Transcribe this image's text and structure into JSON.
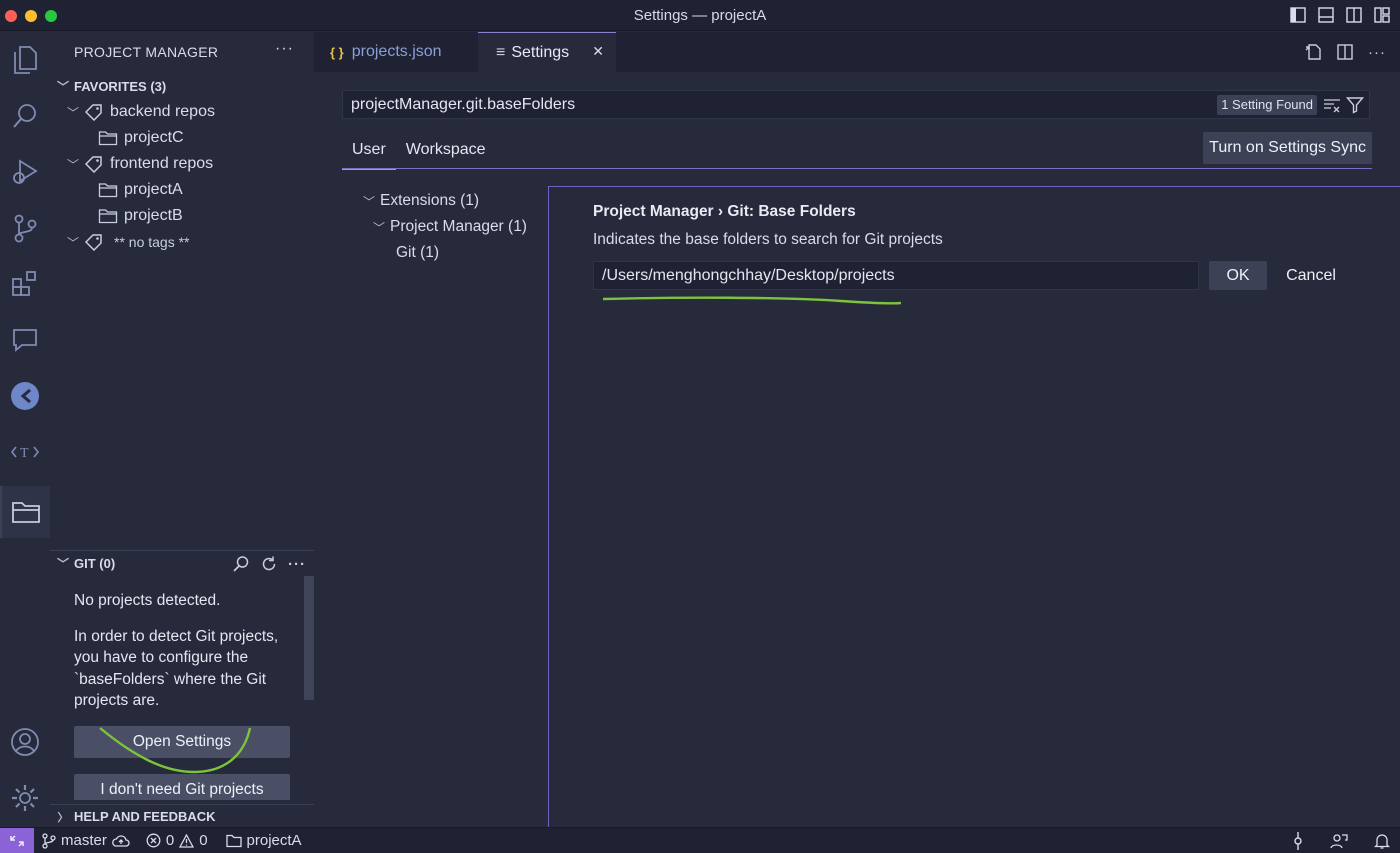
{
  "window": {
    "title": "Settings — projectA"
  },
  "activity_bar": {
    "items": [
      "explorer-icon",
      "search-icon",
      "run-debug-icon",
      "source-control-icon",
      "extensions-icon",
      "comments-icon",
      "remote-icon",
      "translate-icon",
      "project-manager-icon"
    ],
    "bottom": [
      "account-icon",
      "manage-gear-icon"
    ]
  },
  "sidebar": {
    "title": "PROJECT MANAGER",
    "favorites": {
      "header": "FAVORITES (3)",
      "groups": [
        {
          "tag": "backend repos",
          "projects": [
            "projectC"
          ]
        },
        {
          "tag": "frontend repos",
          "projects": [
            "projectA",
            "projectB"
          ]
        },
        {
          "tag": "** no tags **",
          "projects": []
        }
      ]
    },
    "git": {
      "header": "GIT (0)",
      "message1": "No projects detected.",
      "message2": "In order to detect Git projects, you have to configure the `baseFolders` where the Git projects are.",
      "open_settings_label": "Open Settings",
      "dont_need_label": "I don't need Git projects"
    },
    "help": {
      "header": "HELP AND FEEDBACK"
    }
  },
  "tabs": [
    {
      "icon": "{ }",
      "label": "projects.json"
    },
    {
      "icon": "≡",
      "label": "Settings",
      "close": "✕"
    }
  ],
  "settings": {
    "search_value": "projectManager.git.baseFolders",
    "found_badge": "1 Setting Found",
    "scope_tabs": [
      "User",
      "Workspace"
    ],
    "active_scope": "User",
    "sync_button": "Turn on Settings Sync",
    "toc": [
      "Extensions (1)",
      "Project Manager (1)",
      "Git (1)"
    ],
    "setting": {
      "title": "Project Manager › Git: Base Folders",
      "description": "Indicates the base folders to search for Git projects",
      "value": "/Users/menghongchhay/Desktop/projects",
      "ok_label": "OK",
      "cancel_label": "Cancel"
    }
  },
  "statusbar": {
    "branch": "master",
    "errors": "0",
    "warnings": "0",
    "project": "projectA"
  },
  "colors": {
    "accent": "#8c63d6",
    "annotation": "#7cc43c",
    "background": "#262a3b",
    "panel": "#1f2233"
  }
}
